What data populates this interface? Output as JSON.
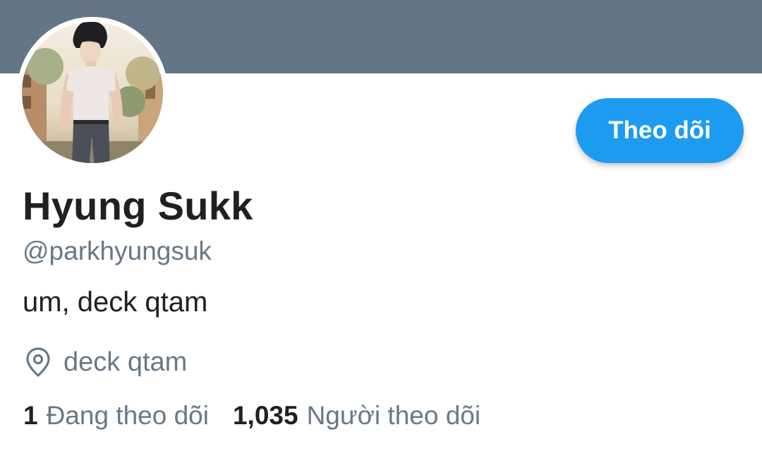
{
  "profile": {
    "banner_color": "#647587",
    "avatar_description": "illustrated young man in white t-shirt and dark trousers",
    "display_name": "Hyung Sukk",
    "handle": "@parkhyungsuk",
    "bio": "um, deck qtam",
    "location": "deck qtam",
    "location_icon": "location-pin-icon",
    "follow_button_label": "Theo dõi",
    "follow_button_color": "#1d9bf0",
    "following_count": "1",
    "following_label": "Đang theo dõi",
    "followers_count": "1,035",
    "followers_label": "Người theo dõi"
  }
}
